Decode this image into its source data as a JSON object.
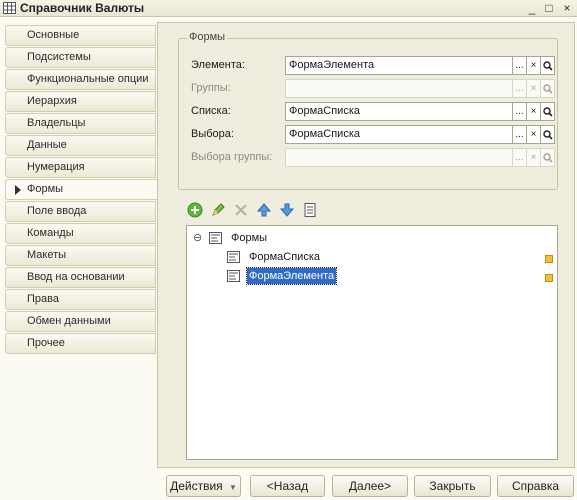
{
  "window": {
    "title": "Справочник Валюты",
    "controls": {
      "minimize": "_",
      "maximize": "□",
      "close": "×"
    },
    "icon": "grid-table-icon"
  },
  "sidebar": {
    "items": [
      {
        "label": "Основные",
        "active": false
      },
      {
        "label": "Подсистемы",
        "active": false
      },
      {
        "label": "Функциональные опции",
        "active": false
      },
      {
        "label": "Иерархия",
        "active": false
      },
      {
        "label": "Владельцы",
        "active": false
      },
      {
        "label": "Данные",
        "active": false
      },
      {
        "label": "Нумерация",
        "active": false
      },
      {
        "label": "Формы",
        "active": true
      },
      {
        "label": "Поле ввода",
        "active": false
      },
      {
        "label": "Команды",
        "active": false
      },
      {
        "label": "Макеты",
        "active": false
      },
      {
        "label": "Ввод на основании",
        "active": false
      },
      {
        "label": "Права",
        "active": false
      },
      {
        "label": "Обмен данными",
        "active": false
      },
      {
        "label": "Прочее",
        "active": false
      }
    ]
  },
  "forms_group": {
    "legend": "Формы",
    "rows": [
      {
        "label": "Элемента:",
        "value": "ФормаЭлемента",
        "enabled": true
      },
      {
        "label": "Группы:",
        "value": "",
        "enabled": false
      },
      {
        "label": "Списка:",
        "value": "ФормаСписка",
        "enabled": true
      },
      {
        "label": "Выбора:",
        "value": "ФормаСписка",
        "enabled": true
      },
      {
        "label": "Выбора группы:",
        "value": "",
        "enabled": false
      }
    ],
    "field_buttons": {
      "select": "...",
      "clear": "×",
      "open": "search-icon"
    }
  },
  "toolbar": {
    "buttons": [
      "add-icon",
      "edit-icon",
      "delete-icon",
      "move-up-icon",
      "move-down-icon",
      "list-icon"
    ]
  },
  "tree": {
    "root": {
      "label": "Формы",
      "expanded": true,
      "toggle": "⊖"
    },
    "children": [
      {
        "label": "ФормаСписка",
        "selected": false
      },
      {
        "label": "ФормаЭлемента",
        "selected": true
      }
    ]
  },
  "footer": {
    "actions_label": "Действия",
    "back_label": "<Назад",
    "next_label": "Далее>",
    "close_label": "Закрыть",
    "help_label": "Справка"
  },
  "colors": {
    "selection": "#3169c6",
    "panel": "#efedde",
    "background": "#fbfaf3"
  }
}
